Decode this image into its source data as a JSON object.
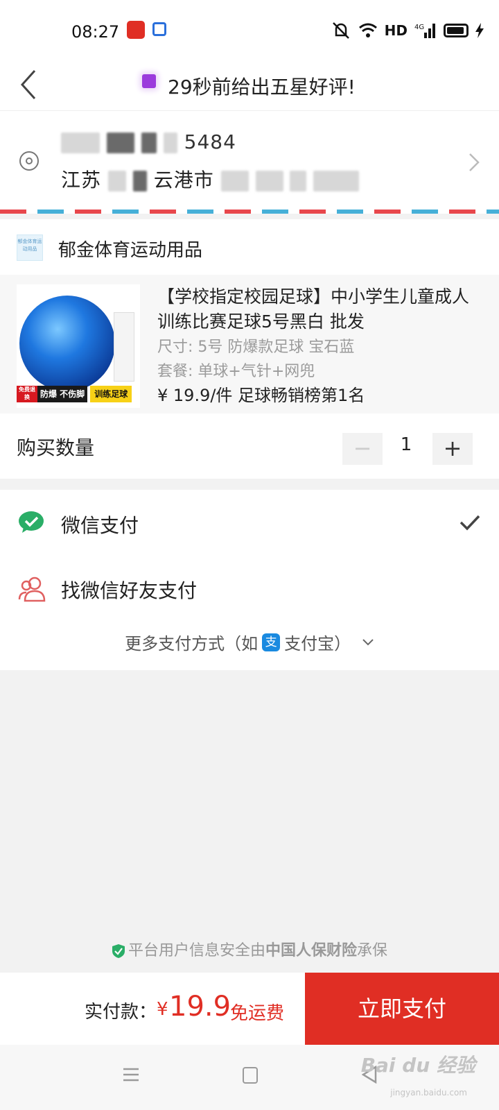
{
  "status_bar": {
    "time": "08:27",
    "network": "HD"
  },
  "header": {
    "title": "29秒前给出五星好评!"
  },
  "address": {
    "line1_visible": "5484",
    "line2_prefix": "江苏",
    "line2_city": "云港市"
  },
  "shop": {
    "name": "郁金体育运动用品",
    "logo_text": "郁金体育运动用品"
  },
  "product": {
    "title": "【学校指定校园足球】中小学生儿童成人训练比赛足球5号黑白 批发",
    "spec": "尺寸: 5号 防爆款足球 宝石蓝",
    "package": "套餐: 单球+气针+网兜",
    "price_line": "¥ 19.9/件 足球畅销榜第1名",
    "image_tags": {
      "tag1": "免费退换",
      "tag2": "防爆 不伤脚",
      "tag3": "训练足球"
    }
  },
  "quantity": {
    "label": "购买数量",
    "value": "1",
    "minus": "−",
    "plus": "+"
  },
  "payment": {
    "wechat_label": "微信支付",
    "friend_label": "找微信好友支付",
    "more_prefix": "更多支付方式（如",
    "alipay_glyph": "支",
    "more_suffix": "支付宝）"
  },
  "security": {
    "text_prefix": "平台用户信息安全由",
    "brand": "中国人保财险",
    "text_suffix": "承保"
  },
  "bottom_bar": {
    "total_label": "实付款：",
    "currency": "¥",
    "amount": "19.9",
    "shipping": "免运费",
    "pay_button": "立即支付"
  },
  "watermark": {
    "text": "Bai du 经验",
    "sub": "jingyan.baidu.com"
  },
  "colors": {
    "accent": "#e02e24",
    "wechat": "#2aae67",
    "alipay": "#1a8ae0"
  }
}
